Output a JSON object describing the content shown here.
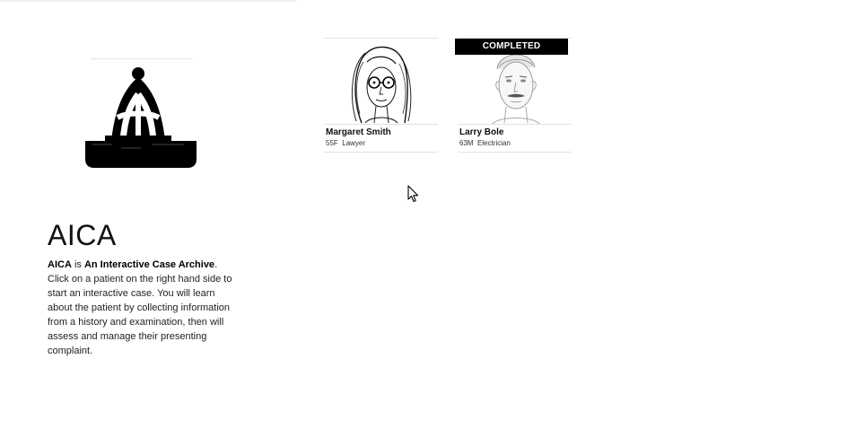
{
  "app": {
    "title": "AICA",
    "intro_name": "AICA",
    "intro_is": " is ",
    "intro_expansion": "An Interactive Case Archive",
    "intro_rest": ". Click on a patient on the right hand side to start an interactive case. You will learn about the patient by collecting information from a history and examination, then will assess and manage their presenting complaint."
  },
  "patients": [
    {
      "name": "Margaret Smith",
      "age_sex": "55F",
      "occupation": "Lawyer",
      "completed": false,
      "portrait": "woman-glasses-portrait"
    },
    {
      "name": "Larry Bole",
      "age_sex": "63M",
      "occupation": "Electrician",
      "completed": true,
      "portrait": "man-moustache-portrait"
    }
  ],
  "badge": {
    "completed_label": "COMPLETED"
  },
  "icons": {
    "logo": "dome-logo-icon",
    "cursor": "mouse-pointer-icon"
  }
}
